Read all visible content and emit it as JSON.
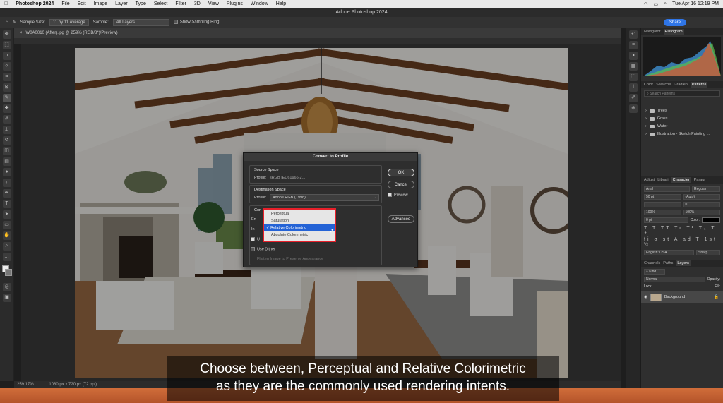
{
  "mac": {
    "apple": "",
    "menus": [
      "Photoshop 2024",
      "File",
      "Edit",
      "Image",
      "Layer",
      "Type",
      "Select",
      "Filter",
      "3D",
      "View",
      "Plugins",
      "Window",
      "Help"
    ],
    "clock": "Tue Apr 16  12:19 PM"
  },
  "window": {
    "title": "Adobe Photoshop 2024"
  },
  "options": {
    "sample_size_label": "Sample Size:",
    "sample_size_value": "11 by 11 Average",
    "sample_label": "Sample:",
    "sample_value": "All Layers",
    "sampling_ring_label": "Show Sampling Ring",
    "share_label": "Share"
  },
  "doc_tab": {
    "label": "_W0A0010 (After).jpg @ 259% (RGB/8*)/Preview)"
  },
  "status": {
    "zoom": "259.17%",
    "dims": "1080 px x 720 px (72 ppi)"
  },
  "dialog": {
    "title": "Convert to Profile",
    "source_title": "Source Space",
    "source_profile_label": "Profile:",
    "source_profile_value": "sRGB IEC61966-2.1",
    "dest_title": "Destination Space",
    "dest_profile_label": "Profile:",
    "dest_profile_value": "Adobe RGB (1998)",
    "conv_title": "Con",
    "engine_label": "En",
    "intent_label": "In",
    "use_bpc_label": "U",
    "use_dither_label": "Use Dither",
    "flatten_label": "Flatten Image to Preserve Appearance",
    "ok": "OK",
    "cancel": "Cancel",
    "preview": "Preview",
    "advanced": "Advanced"
  },
  "intent_menu": {
    "items": [
      "Perceptual",
      "Saturation",
      "✓ Relative Colorimetric",
      "Absolute Colorimetric"
    ],
    "selected_index": 2
  },
  "panels": {
    "top_tabs": [
      "Navigator",
      "Histogram"
    ],
    "pattern_tabs": [
      "Color",
      "Swatche",
      "Gradien",
      "Patterns"
    ],
    "search_placeholder": "Search Patterns",
    "folders": [
      "Trees",
      "Grass",
      "Water",
      "Illustration - Sketch Painting ..."
    ],
    "char_tabs": [
      "Adjust",
      "Librari",
      "Character",
      "Paragr"
    ],
    "font_family": "Arial",
    "font_style": "Regular",
    "font_size": "50 pt",
    "leading": "(Auto)",
    "tracking": "0",
    "scale_v": "100%",
    "scale_h": "100%",
    "baseline": "0 pt",
    "color_label": "Color:",
    "language": "English: USA",
    "aa": "Sharp",
    "layer_tabs": [
      "Channels",
      "Paths",
      "Layers"
    ],
    "kind_label": "Kind",
    "blend_mode": "Normal",
    "opacity_label": "Opacity:",
    "lock_label": "Lock:",
    "fill_label": "Fill:",
    "layer_name": "Background"
  },
  "subtitle": {
    "line1": "Choose between, Perceptual and Relative Colorimetric",
    "line2": "as they are the commonly used rendering intents."
  }
}
